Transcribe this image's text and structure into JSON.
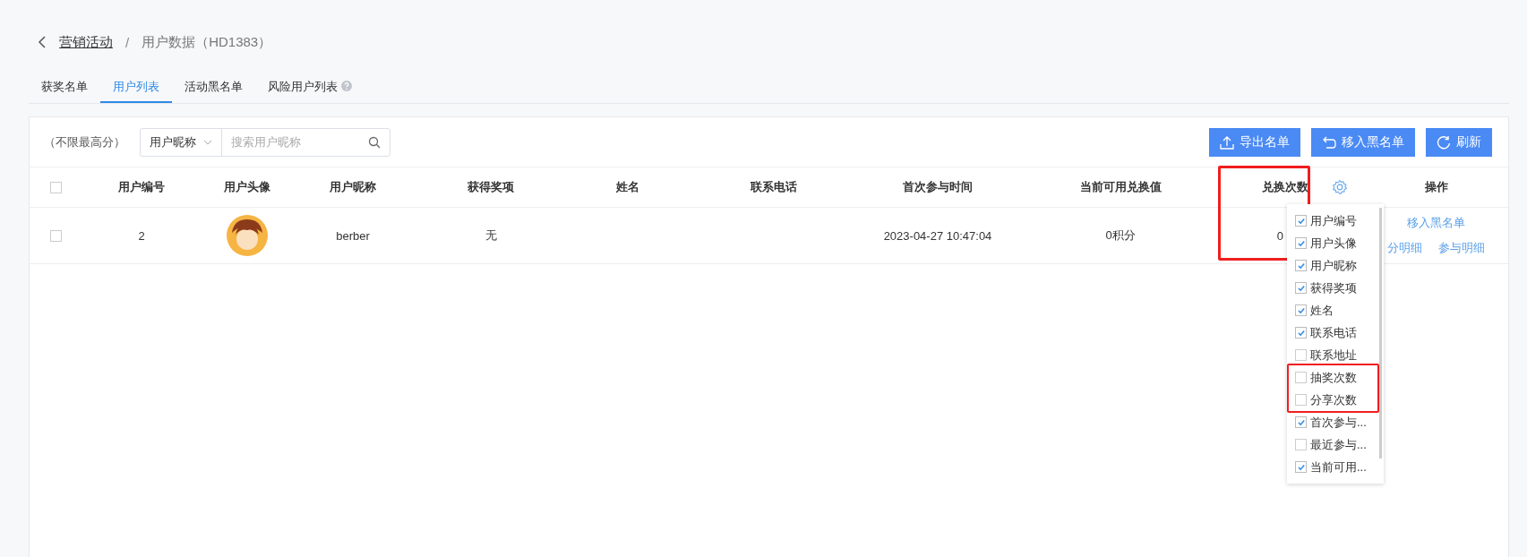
{
  "breadcrumb": {
    "parent": "营销活动",
    "separator": "/",
    "current": "用户数据（HD1383）"
  },
  "tabs": [
    {
      "label": "获奖名单",
      "selected": false,
      "help": false
    },
    {
      "label": "用户列表",
      "selected": true,
      "help": false
    },
    {
      "label": "活动黑名单",
      "selected": false,
      "help": false
    },
    {
      "label": "风险用户列表",
      "selected": false,
      "help": true
    }
  ],
  "filter_note": "（不限最高分）",
  "search": {
    "field": "用户昵称",
    "placeholder": "搜索用户昵称"
  },
  "buttons": [
    {
      "label": "导出名单",
      "kind": "upload"
    },
    {
      "label": "移入黑名单",
      "kind": "return"
    },
    {
      "label": "刷新",
      "kind": "refresh"
    }
  ],
  "table": {
    "header_checked": false,
    "columns": [
      "用户编号",
      "用户头像",
      "用户昵称",
      "获得奖项",
      "姓名",
      "联系电话",
      "首次参与时间",
      "当前可用兑换值",
      "兑换次数",
      "操作"
    ],
    "rows": [
      {
        "checked": false,
        "user_id": "2",
        "nickname": "berber",
        "prize": "无",
        "first_time": "2023-04-27 10:47:04",
        "available": "0积分",
        "exchange_count": "0",
        "actions": [
          {
            "label": "移入黑名单"
          },
          {
            "label": "分明细"
          },
          {
            "label": "参与明细"
          }
        ]
      }
    ]
  },
  "column_picker": [
    {
      "label": "用户编号",
      "checked": true
    },
    {
      "label": "用户头像",
      "checked": true
    },
    {
      "label": "用户昵称",
      "checked": true
    },
    {
      "label": "获得奖项",
      "checked": true
    },
    {
      "label": "姓名",
      "checked": true
    },
    {
      "label": "联系电话",
      "checked": true
    },
    {
      "label": "联系地址",
      "checked": false
    },
    {
      "label": "抽奖次数",
      "checked": false
    },
    {
      "label": "分享次数",
      "checked": false
    },
    {
      "label": "首次参与...",
      "checked": true
    },
    {
      "label": "最近参与...",
      "checked": false
    },
    {
      "label": "当前可用...",
      "checked": true
    }
  ]
}
